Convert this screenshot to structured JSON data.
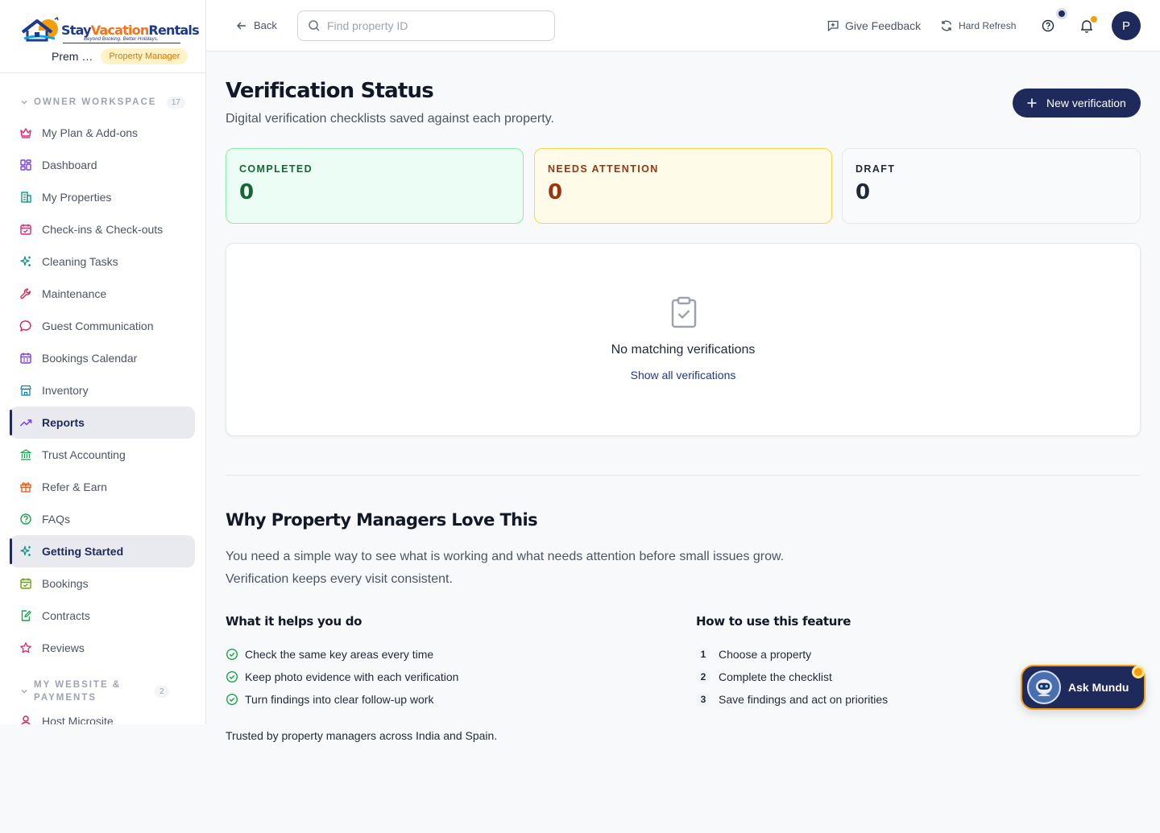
{
  "brand": {
    "name_part1": "Stay",
    "name_part2": "Vacation",
    "name_part3": "Rentals",
    "tagline": "Beyond Booking. Better Holidays.",
    "user_name": "Prem …",
    "role": "Property Manager"
  },
  "sidebar": {
    "section1": {
      "label": "OWNER WORKSPACE",
      "count": "17"
    },
    "items": [
      {
        "label": "My Plan & Add-ons",
        "icon": "crown-icon",
        "color": "#db2777"
      },
      {
        "label": "Dashboard",
        "icon": "dashboard-icon",
        "color": "#7c3aed"
      },
      {
        "label": "My Properties",
        "icon": "building-icon",
        "color": "#0d9488"
      },
      {
        "label": "Check-ins & Check-outs",
        "icon": "calendar-check-icon",
        "color": "#db2777"
      },
      {
        "label": "Cleaning Tasks",
        "icon": "sparkles-icon",
        "color": "#0d9488"
      },
      {
        "label": "Maintenance",
        "icon": "wrench-icon",
        "color": "#e11d48"
      },
      {
        "label": "Guest Communication",
        "icon": "chat-icon",
        "color": "#e11d48"
      },
      {
        "label": "Bookings Calendar",
        "icon": "calendar-icon",
        "color": "#7c3aed"
      },
      {
        "label": "Inventory",
        "icon": "store-icon",
        "color": "#0284c7"
      },
      {
        "label": "Reports",
        "icon": "trending-up-icon",
        "color": "#7c3aed"
      },
      {
        "label": "Trust Accounting",
        "icon": "bank-icon",
        "color": "#16a34a"
      },
      {
        "label": "Refer & Earn",
        "icon": "gift-icon",
        "color": "#ea580c"
      },
      {
        "label": "FAQs",
        "icon": "help-circle-icon",
        "color": "#16a34a"
      },
      {
        "label": "Getting Started",
        "icon": "sparkles-icon",
        "color": "#0d9488"
      },
      {
        "label": "Bookings",
        "icon": "calendar-check-icon",
        "color": "#65a30d"
      },
      {
        "label": "Contracts",
        "icon": "file-edit-icon",
        "color": "#16a34a"
      },
      {
        "label": "Reviews",
        "icon": "star-icon",
        "color": "#db2777"
      }
    ],
    "section2": {
      "label": "MY WEBSITE & PAYMENTS",
      "count": "2"
    },
    "items2": [
      {
        "label": "Host Microsite",
        "icon": "user-icon",
        "color": "#e11d48"
      }
    ]
  },
  "topbar": {
    "back_label": "Back",
    "search_placeholder": "Find property ID",
    "feedback_label": "Give Feedback",
    "refresh_label": "Hard Refresh",
    "avatar_initial": "P"
  },
  "main": {
    "title": "Verification Status",
    "subtitle": "Digital verification checklists saved against each property.",
    "new_button": "New verification",
    "stats": [
      {
        "label": "COMPLETED",
        "value": "0"
      },
      {
        "label": "NEEDS ATTENTION",
        "value": "0"
      },
      {
        "label": "DRAFT",
        "value": "0"
      }
    ],
    "empty_title": "No matching verifications",
    "empty_link": "Show all verifications",
    "why_title": "Why Property Managers Love This",
    "why_desc_1": "You need a simple way to see what is working and what needs attention before small issues grow.",
    "why_desc_2": "Verification keeps every visit consistent.",
    "helps_title": "What it helps you do",
    "helps": [
      "Check the same key areas every time",
      "Keep photo evidence with each verification",
      "Turn findings into clear follow-up work"
    ],
    "howto_title": "How to use this feature",
    "howto": [
      {
        "n": "1",
        "text": "Choose a property"
      },
      {
        "n": "2",
        "text": "Complete the checklist"
      },
      {
        "n": "3",
        "text": "Save findings and act on priorities"
      }
    ],
    "trusted": "Trusted by property managers across India and Spain."
  },
  "assistant": {
    "label": "Ask Mundu"
  },
  "colors": {
    "primary": "#1e2a5c",
    "accent": "#f59e0b"
  }
}
